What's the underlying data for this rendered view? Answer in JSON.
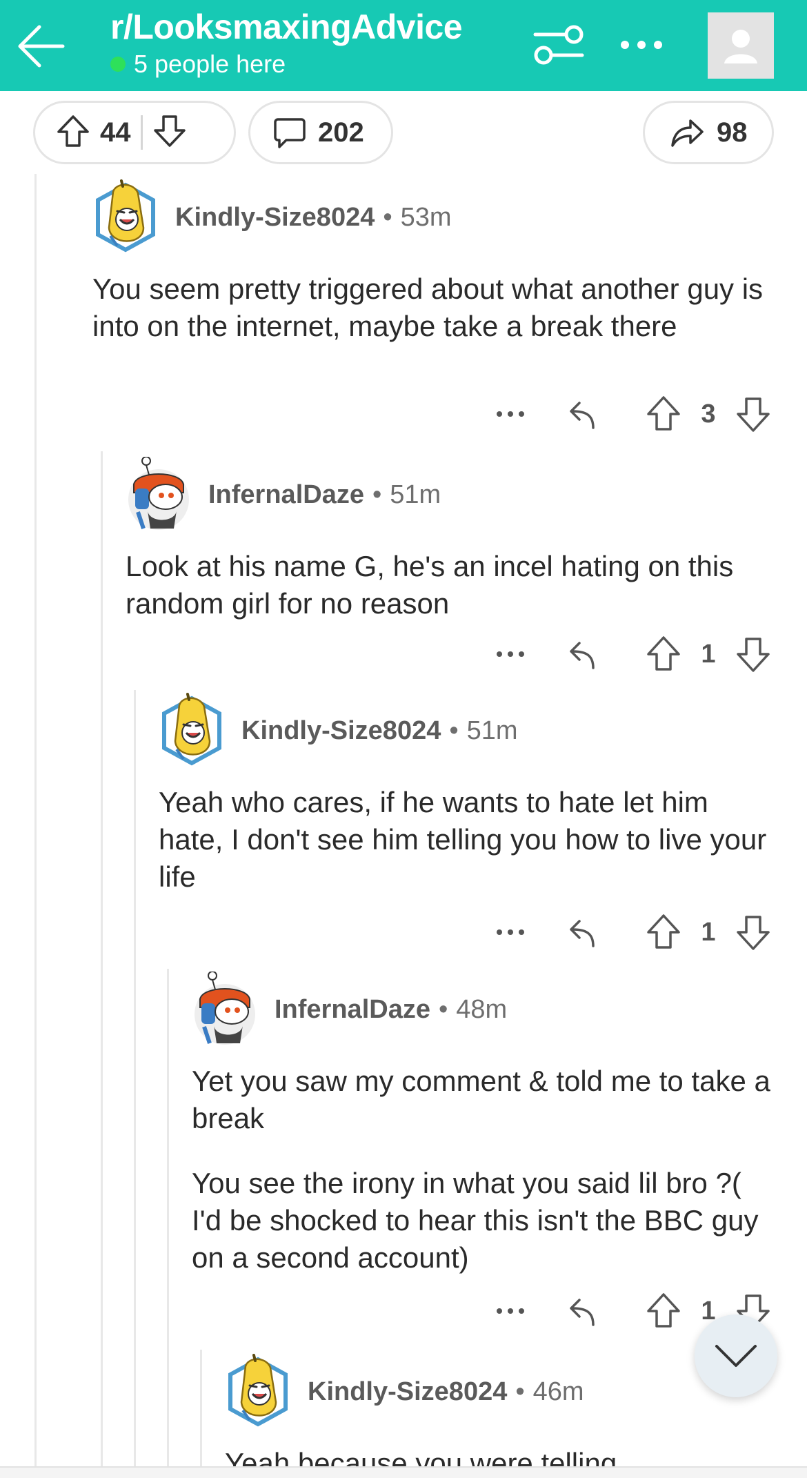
{
  "header": {
    "back_icon": "arrow-left-icon",
    "subreddit": "r/LooksmaxingAdvice",
    "online_text": "5 people here",
    "filter_icon": "filter-sliders-icon",
    "more_icon": "more-horizontal-icon",
    "user_icon": "user-avatar-icon",
    "colors": {
      "header_bg": "#17c9b4",
      "online_dot": "#2ee05a"
    }
  },
  "post_actions": {
    "upvotes": "44",
    "comments": "202",
    "shares": "98"
  },
  "comments": [
    {
      "user": "Kindly-Size8024",
      "sep": "•",
      "time": "53m",
      "paragraphs": [
        "You seem pretty triggered about what another guy is into on the internet, maybe take a break there"
      ],
      "score": "3"
    },
    {
      "user": "InfernalDaze",
      "sep": "•",
      "time": "51m",
      "paragraphs": [
        "Look at his name G, he's an incel hating on this random girl for no reason"
      ],
      "score": "1"
    },
    {
      "user": "Kindly-Size8024",
      "sep": "•",
      "time": "51m",
      "paragraphs": [
        "Yeah who cares, if he wants to hate let him hate, I don't see him telling you how to live your life"
      ],
      "score": "1"
    },
    {
      "user": "InfernalDaze",
      "sep": "•",
      "time": "48m",
      "paragraphs": [
        "Yet you saw my comment & told me to take a break",
        "You see the irony in what you said lil bro ?( I'd be shocked to hear this isn't the BBC guy on a second account)"
      ],
      "score": "1"
    },
    {
      "user": "Kindly-Size8024",
      "sep": "•",
      "time": "46m",
      "paragraphs": [
        "Yeah because you were telling"
      ],
      "score": ""
    }
  ],
  "action_icons": {
    "more": "more-horizontal-icon",
    "reply": "reply-icon",
    "up": "upvote-icon",
    "down": "downvote-icon"
  },
  "fab_icon": "chevron-down-icon"
}
